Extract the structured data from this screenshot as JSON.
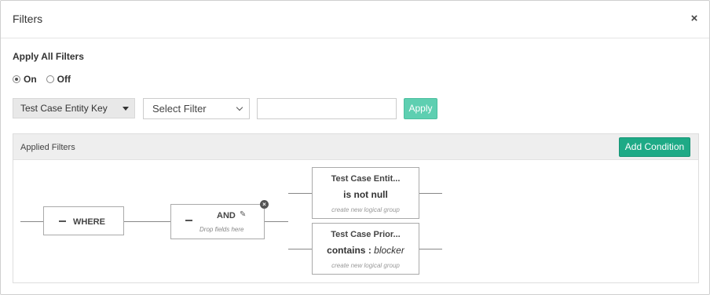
{
  "modal": {
    "title": "Filters",
    "close_label": "×"
  },
  "apply_all": {
    "label": "Apply All Filters",
    "options": [
      {
        "label": "On",
        "selected": true
      },
      {
        "label": "Off",
        "selected": false
      }
    ]
  },
  "filter_bar": {
    "entity_select_value": "Test Case Entity Key",
    "filter_select_value": "Select Filter",
    "value_input": "",
    "apply_label": "Apply"
  },
  "applied": {
    "title": "Applied Filters",
    "add_condition_label": "Add Condition",
    "root": {
      "label": "WHERE"
    },
    "group": {
      "label": "AND",
      "hint": "Drop fields here",
      "remove_label": "×"
    },
    "conditions": [
      {
        "field": "Test Case Entit...",
        "operator": "is not null",
        "value": "",
        "hint": "create new logical group"
      },
      {
        "field": "Test Case Prior...",
        "operator": "contains :",
        "value": "blocker",
        "hint": "create new logical group"
      }
    ]
  },
  "icons": {
    "close": "close-icon",
    "edit": "pencil-icon",
    "remove": "remove-circle-icon",
    "collapse": "minus-icon"
  },
  "colors": {
    "apply": "#5ecfb1",
    "add_condition": "#1eaa86"
  }
}
